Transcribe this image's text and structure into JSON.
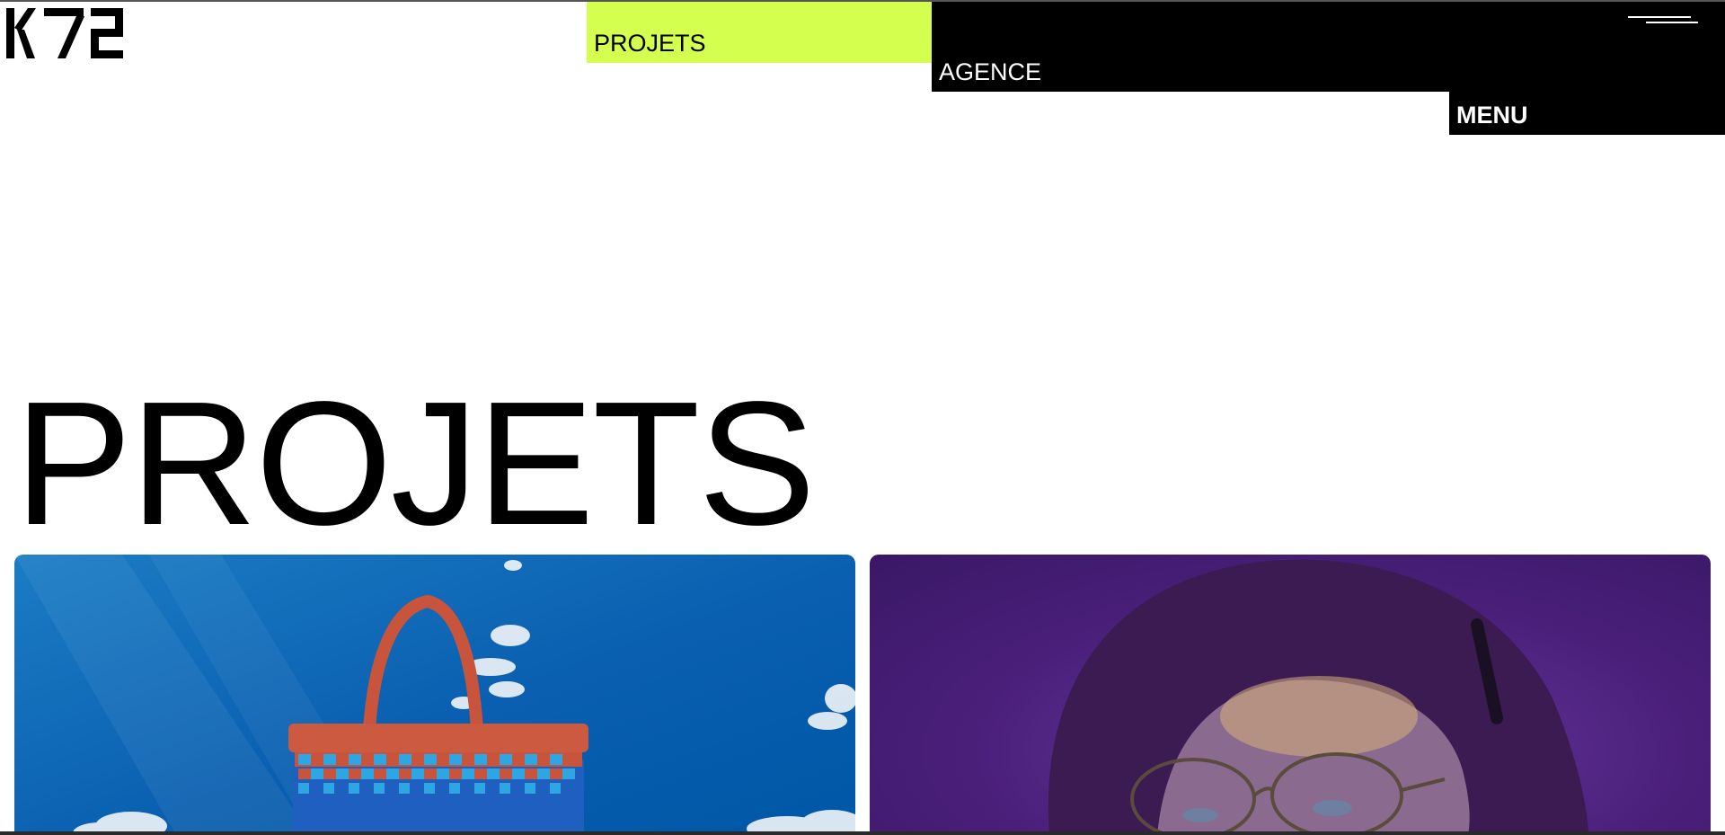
{
  "header": {
    "logo_text": "K72",
    "nav": {
      "projets_label": "PROJETS",
      "agence_label": "AGENCE",
      "menu_label": "MENU"
    },
    "menu_icon": "hamburger-icon"
  },
  "main": {
    "title": "PROJETS",
    "projects": [
      {
        "image": "blue-sky-tote-bag"
      },
      {
        "image": "purple-portrait-glasses"
      }
    ]
  },
  "colors": {
    "accent": "#d4ff4f",
    "nav_dark": "#000000",
    "background": "#ffffff"
  }
}
